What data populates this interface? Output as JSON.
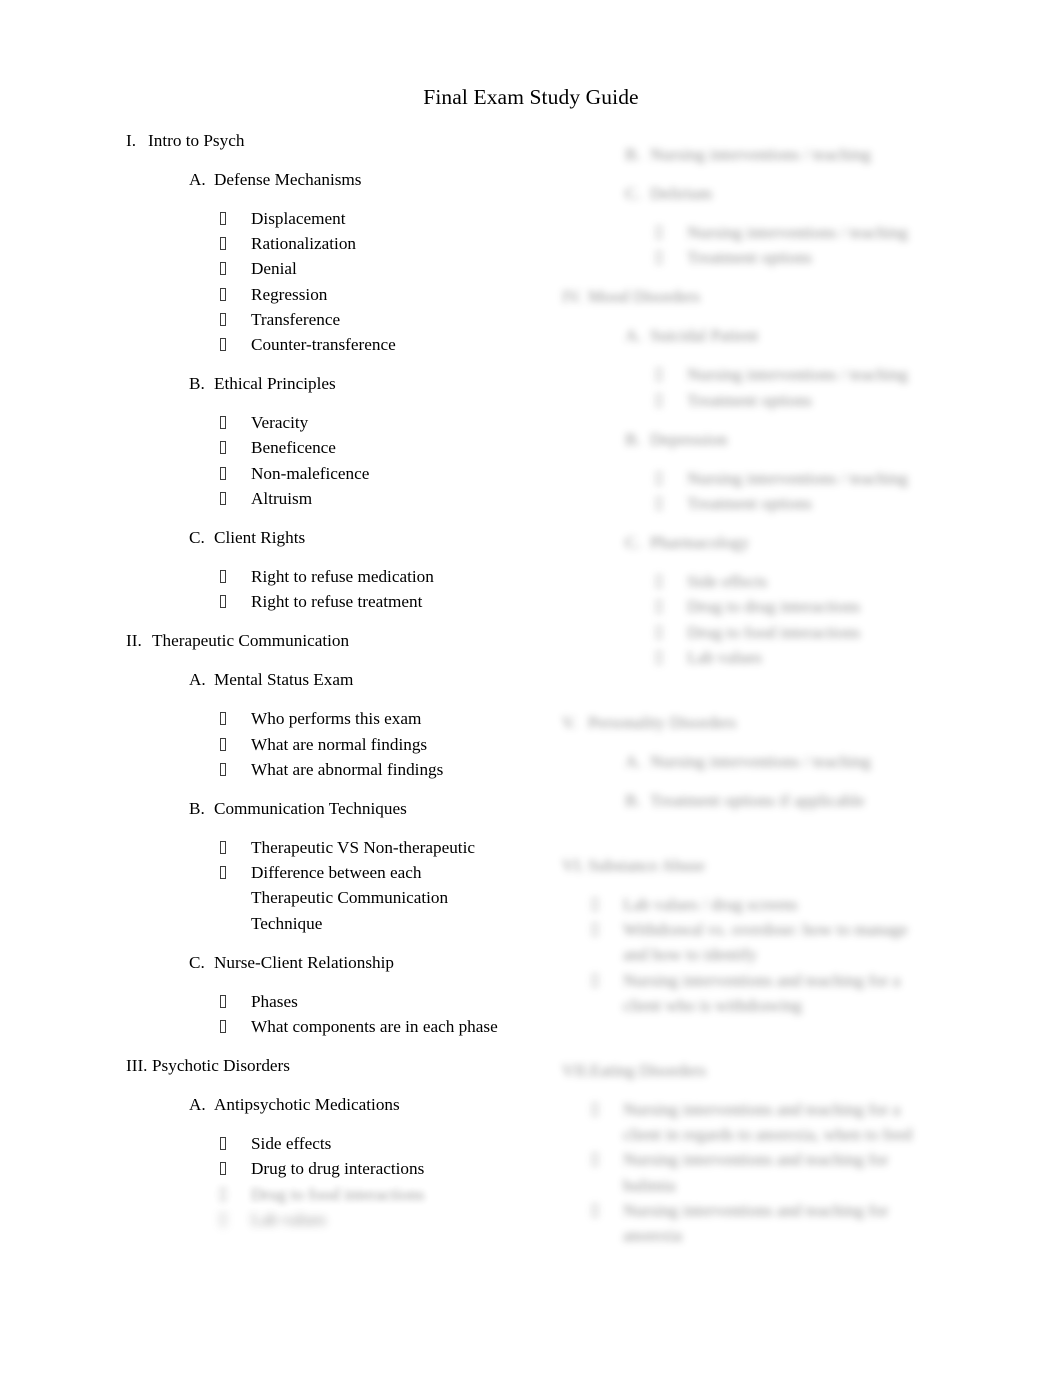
{
  "document": {
    "title": "Final Exam Study Guide",
    "bullet_glyph": "missing-glyph-box"
  },
  "left_column": {
    "sections": [
      {
        "marker": "I.",
        "title": "Intro to Psych",
        "redacted": false,
        "subsections": [
          {
            "marker": "A.",
            "title": "Defense Mechanisms",
            "redacted": false,
            "items": [
              {
                "text": "Displacement",
                "redacted": false
              },
              {
                "text": "Rationalization",
                "redacted": false
              },
              {
                "text": "Denial",
                "redacted": false
              },
              {
                "text": "Regression",
                "redacted": false
              },
              {
                "text": "Transference",
                "redacted": false
              },
              {
                "text": "Counter-transference",
                "redacted": false
              }
            ]
          },
          {
            "marker": "B.",
            "title": "Ethical Principles",
            "redacted": false,
            "items": [
              {
                "text": "Veracity",
                "redacted": false
              },
              {
                "text": "Beneficence",
                "redacted": false
              },
              {
                "text": "Non-maleficence",
                "redacted": false
              },
              {
                "text": "Altruism",
                "redacted": false
              }
            ]
          },
          {
            "marker": "C.",
            "title": "Client Rights",
            "redacted": false,
            "items": [
              {
                "text": "Right to refuse medication",
                "redacted": false
              },
              {
                "text": "Right to refuse treatment",
                "redacted": false
              }
            ]
          }
        ]
      },
      {
        "marker": "II.",
        "title": "Therapeutic Communication",
        "redacted": false,
        "subsections": [
          {
            "marker": "A.",
            "title": "Mental Status Exam",
            "redacted": false,
            "items": [
              {
                "text": "Who performs this exam",
                "redacted": false
              },
              {
                "text": "What are normal findings",
                "redacted": false
              },
              {
                "text": "What are abnormal findings",
                "redacted": false
              }
            ]
          },
          {
            "marker": "B.",
            "title": "Communication Techniques",
            "redacted": false,
            "items": [
              {
                "text": "Therapeutic VS Non-therapeutic",
                "redacted": false
              },
              {
                "text": "Difference between each Therapeutic Communication Technique",
                "redacted": false
              }
            ]
          },
          {
            "marker": "C.",
            "title": "Nurse-Client Relationship",
            "redacted": false,
            "items": [
              {
                "text": "Phases",
                "redacted": false
              },
              {
                "text": "What components are in each phase",
                "redacted": false
              }
            ]
          }
        ]
      },
      {
        "marker": "III.",
        "title": "Psychotic Disorders",
        "redacted": false,
        "subsections": [
          {
            "marker": "A.",
            "title": "Antipsychotic Medications",
            "redacted": false,
            "items": [
              {
                "text": "Side effects",
                "redacted": false
              },
              {
                "text": "Drug to drug interactions",
                "redacted": false
              },
              {
                "text": "Drug to food interactions",
                "redacted": true
              },
              {
                "text": "Lab values",
                "redacted": true
              }
            ]
          }
        ]
      }
    ]
  },
  "right_column": {
    "sections": [
      {
        "marker": "",
        "title": "",
        "redacted": true,
        "lead_items": [
          {
            "marker": "B.",
            "text": "Nursing interventions / teaching",
            "redacted": true
          }
        ],
        "subsections": [
          {
            "marker": "C.",
            "title": "Delirium",
            "redacted": true,
            "items": [
              {
                "text": "Nursing interventions / teaching",
                "redacted": true
              },
              {
                "text": "Treatment options",
                "redacted": true
              }
            ]
          }
        ]
      },
      {
        "marker": "IV.",
        "title": "Mood Disorders",
        "redacted": true,
        "subsections": [
          {
            "marker": "A.",
            "title": "Suicidal Patient",
            "redacted": true,
            "items": [
              {
                "text": "Nursing interventions / teaching",
                "redacted": true
              },
              {
                "text": "Treatment options",
                "redacted": true
              }
            ]
          },
          {
            "marker": "B.",
            "title": "Depression",
            "redacted": true,
            "items": [
              {
                "text": "Nursing interventions / teaching",
                "redacted": true
              },
              {
                "text": "Treatment options",
                "redacted": true
              }
            ]
          },
          {
            "marker": "C.",
            "title": "Pharmacology",
            "redacted": true,
            "items": [
              {
                "text": "Side effects",
                "redacted": true
              },
              {
                "text": "Drug to drug interactions",
                "redacted": true
              },
              {
                "text": "Drug to food interactions",
                "redacted": true
              },
              {
                "text": "Lab values",
                "redacted": true
              }
            ]
          }
        ]
      },
      {
        "marker": "V.",
        "title": "Personality Disorders",
        "redacted": true,
        "subsections": [
          {
            "marker": "A.",
            "title": "Nursing interventions / teaching",
            "redacted": true,
            "items": []
          },
          {
            "marker": "B.",
            "title": "Treatment options if applicable",
            "redacted": true,
            "items": []
          }
        ]
      },
      {
        "marker": "VI.",
        "title": "Substance Abuse",
        "redacted": true,
        "subsections": [],
        "items": [
          {
            "text": "Lab values / drug screens",
            "redacted": true
          },
          {
            "text": "Withdrawal vs. overdose: how to manage and how to identify",
            "redacted": true
          },
          {
            "text": "Nursing interventions and teaching for a client who is withdrawing",
            "redacted": true
          }
        ]
      },
      {
        "marker": "VII.",
        "title": "Eating Disorders",
        "redacted": true,
        "subsections": [],
        "items": [
          {
            "text": "Nursing interventions and teaching for a client in regards to anorexia, when to feed",
            "redacted": true
          },
          {
            "text": "Nursing interventions and teaching for bulimia",
            "redacted": true
          },
          {
            "text": "Nursing interventions and teaching for anorexia",
            "redacted": true
          }
        ]
      }
    ]
  }
}
